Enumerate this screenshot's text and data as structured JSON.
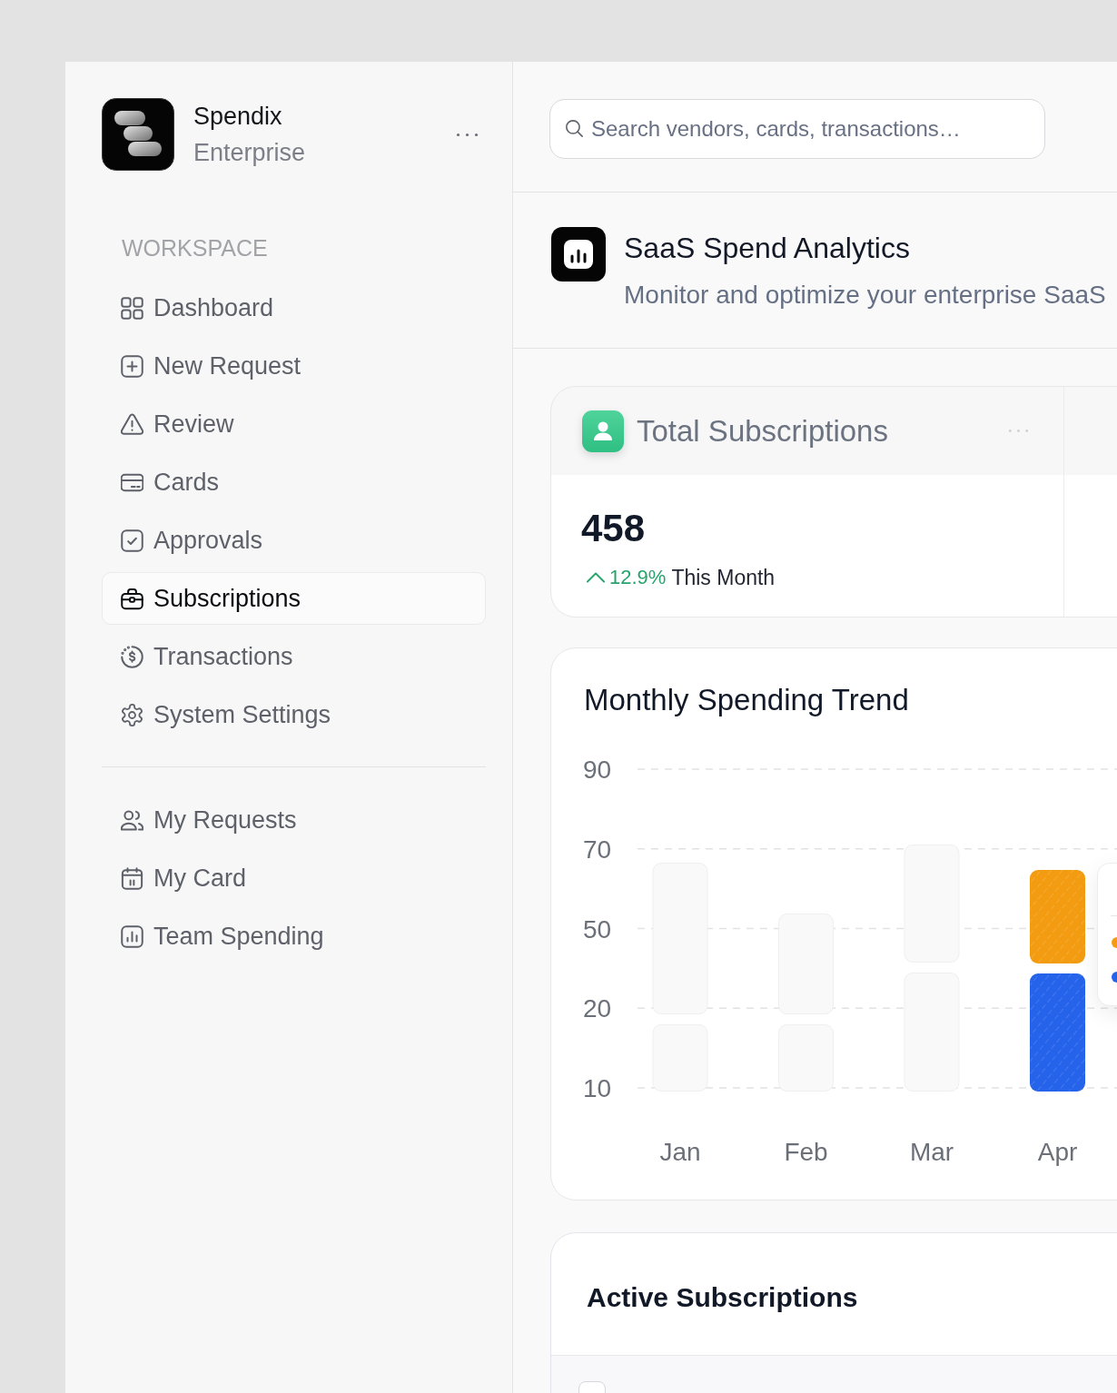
{
  "sidebar": {
    "brand": {
      "name": "Spendix",
      "subtitle": "Enterprise"
    },
    "section_label": "WORKSPACE",
    "nav": [
      {
        "label": "Dashboard",
        "selected": false
      },
      {
        "label": "New Request",
        "selected": false
      },
      {
        "label": "Review",
        "selected": false
      },
      {
        "label": "Cards",
        "selected": false
      },
      {
        "label": "Approvals",
        "selected": false
      },
      {
        "label": "Subscriptions",
        "selected": true
      },
      {
        "label": "Transactions",
        "selected": false
      },
      {
        "label": "System Settings",
        "selected": false
      }
    ],
    "secondary_nav": [
      {
        "label": "My Requests",
        "selected": false
      },
      {
        "label": "My Card",
        "selected": false
      },
      {
        "label": "Team Spending",
        "selected": false
      }
    ]
  },
  "search": {
    "placeholder": "Search vendors, cards, transactions…"
  },
  "page_header": {
    "title": "SaaS Spend Analytics",
    "subtitle": "Monitor and optimize your enterprise SaaS"
  },
  "stats": [
    {
      "title": "Total Subscriptions",
      "value": "458",
      "increase": true,
      "change": "12.9%",
      "period": "This Month"
    }
  ],
  "spending_trend": {
    "title": "Monthly Spending Trend",
    "y_axis_labels": [
      "90",
      "70",
      "50",
      "20",
      "10"
    ],
    "months": [
      {
        "label": "Jan",
        "selected": false
      },
      {
        "label": "Feb",
        "selected": false
      },
      {
        "label": "Mar",
        "selected": false
      },
      {
        "label": "Apr",
        "selected": true
      }
    ],
    "series": [
      {
        "color": "#2563eb"
      },
      {
        "color": "#f39c12"
      }
    ]
  },
  "active_subscriptions": {
    "title": "Active Subscriptions",
    "select_all": {
      "checked": false
    }
  }
}
